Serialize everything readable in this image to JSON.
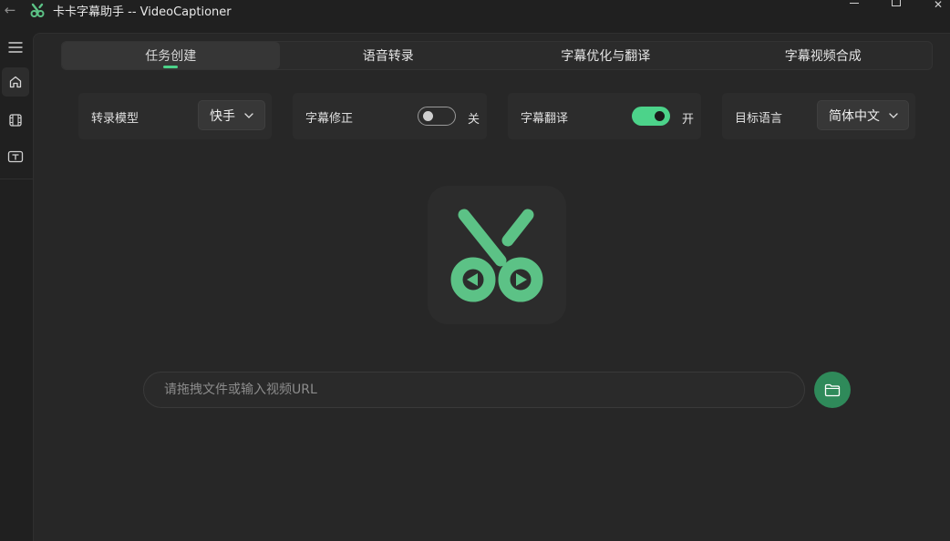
{
  "window": {
    "title": "卡卡字幕助手 -- VideoCaptioner",
    "back_glyph": "←",
    "close_glyph": "✕"
  },
  "sidebar": {
    "items": [
      {
        "icon": "menu-icon"
      },
      {
        "icon": "home-icon",
        "active": true
      },
      {
        "icon": "film-icon"
      },
      {
        "icon": "text-box-icon"
      }
    ]
  },
  "tabs": [
    {
      "label": "任务创建",
      "active": true
    },
    {
      "label": "语音转录"
    },
    {
      "label": "字幕优化与翻译"
    },
    {
      "label": "字幕视频合成"
    }
  ],
  "settings": {
    "transcribe_model": {
      "label": "转录模型",
      "value": "快手"
    },
    "subtitle_correction": {
      "label": "字幕修正",
      "state": "关",
      "enabled": false
    },
    "subtitle_translation": {
      "label": "字幕翻译",
      "state": "开",
      "enabled": true
    },
    "target_language": {
      "label": "目标语言",
      "value": "简体中文"
    }
  },
  "input": {
    "placeholder": "请拖拽文件或输入视频URL",
    "value": ""
  },
  "colors": {
    "accent": "#4cd38a",
    "logo_green": "#5cc286",
    "folder_button": "#2f8a5a",
    "background": "#272727"
  }
}
